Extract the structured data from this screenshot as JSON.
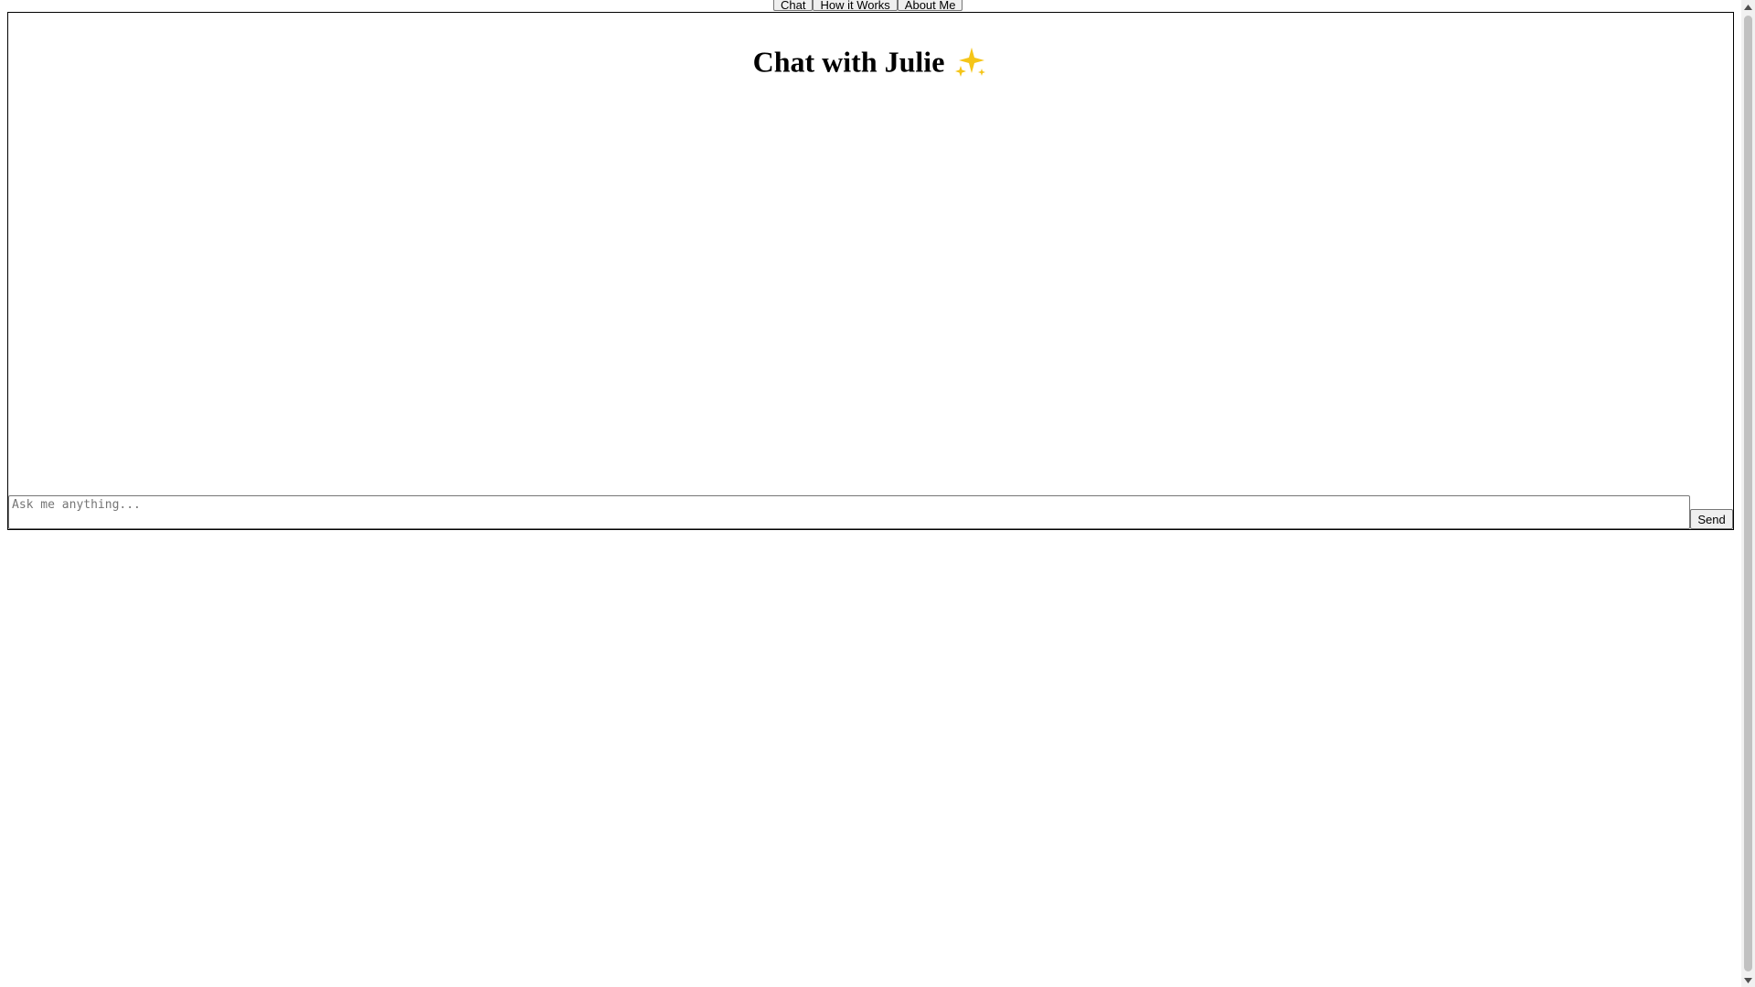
{
  "nav": {
    "tabs": [
      {
        "label": "Chat"
      },
      {
        "label": "How it Works"
      },
      {
        "label": "About Me"
      }
    ]
  },
  "chat": {
    "title": "Chat with Julie",
    "title_icon": "sparkle-icon",
    "input": {
      "placeholder": "Ask me anything...",
      "value": ""
    },
    "send_label": "Send"
  },
  "colors": {
    "border": "#000000",
    "button_bg": "#efefef",
    "sparkle": "#f5c518"
  }
}
